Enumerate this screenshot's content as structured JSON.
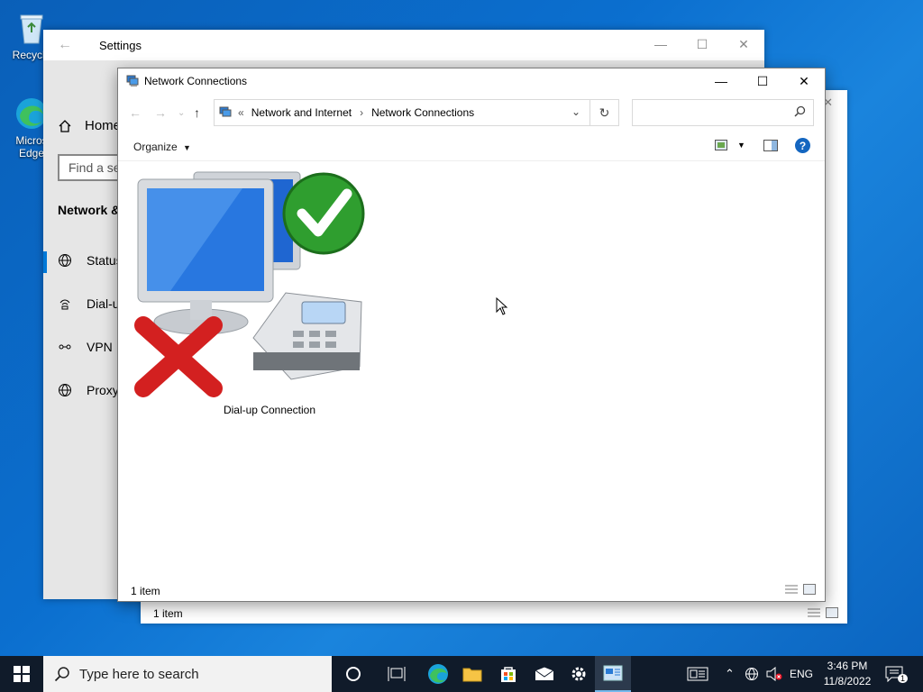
{
  "desktop": {
    "icons": [
      {
        "label": "Recycle"
      },
      {
        "label": "Micros Edge"
      }
    ]
  },
  "settings": {
    "title": "Settings",
    "nav_home": "Home",
    "search_placeholder": "Find a se",
    "section": "Network &",
    "items": [
      {
        "label": "Status",
        "icon": "globe-icon"
      },
      {
        "label": "Dial-u",
        "icon": "dialup-icon"
      },
      {
        "label": "VPN",
        "icon": "vpn-icon"
      },
      {
        "label": "Proxy",
        "icon": "globe-icon"
      }
    ]
  },
  "background_explorer": {
    "status": "1 item"
  },
  "explorer": {
    "title": "Network Connections",
    "breadcrumb": {
      "overflow": "«",
      "parent": "Network and Internet",
      "current": "Network Connections"
    },
    "search_placeholder": "",
    "toolbar": {
      "organize": "Organize"
    },
    "items": [
      {
        "label": "Dial-up Connection",
        "icon": "dialup-connection-icon"
      }
    ],
    "status": "1 item"
  },
  "taskbar": {
    "search_placeholder": "Type here to search",
    "language": "ENG",
    "time": "3:46 PM",
    "date": "11/8/2022",
    "notification_count": "1"
  },
  "colors": {
    "accent": "#0078d7",
    "desktop": "#0b6fcf",
    "taskbar": "#101b2a"
  }
}
